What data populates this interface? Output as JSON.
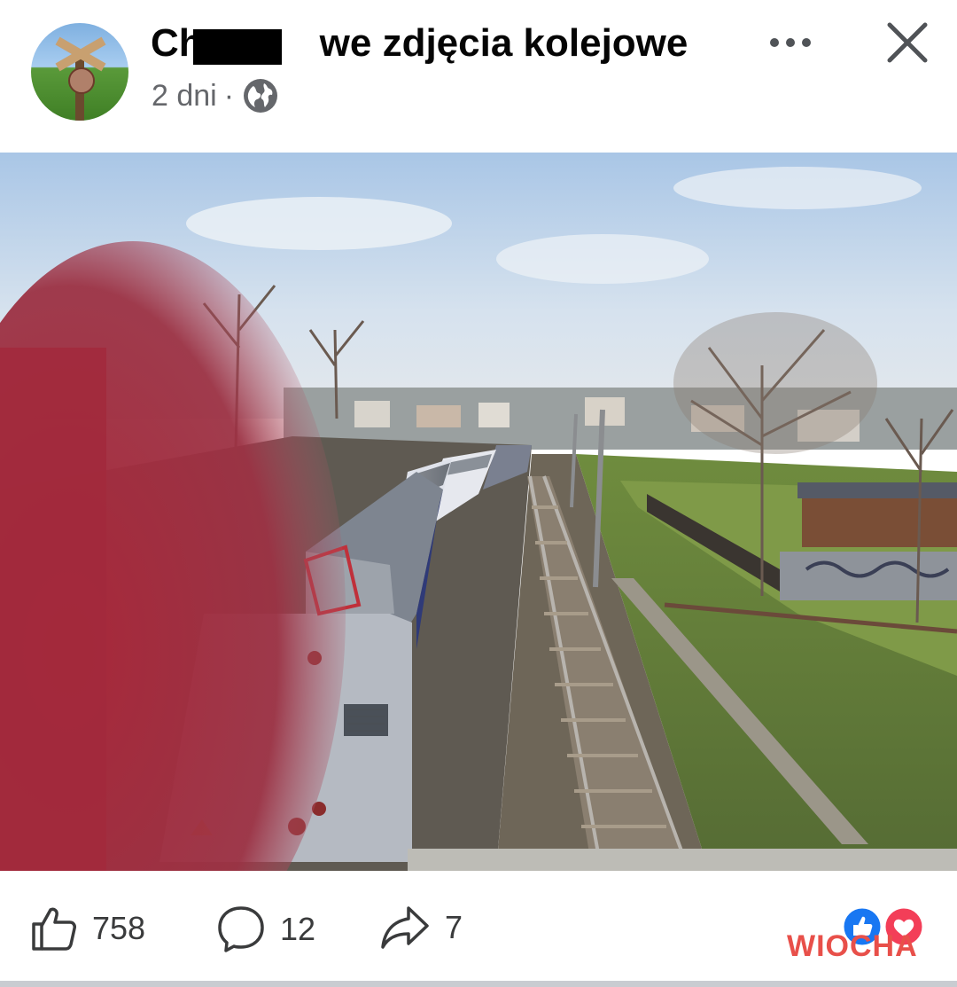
{
  "header": {
    "title_visible": "Ch   we zdjęcia kolejowe",
    "time": "2 dni",
    "separator": "·",
    "privacy_icon": "globe-icon",
    "more_icon": "more-dots-icon",
    "close_icon": "close-icon"
  },
  "photo": {
    "subject": "train"
  },
  "footer": {
    "likes": "758",
    "comments": "12",
    "shares": "7",
    "reactions": [
      "like-reaction-icon",
      "love-reaction-icon"
    ],
    "watermark": "WIOCHA"
  },
  "colors": {
    "text": "#050505",
    "meta": "#65676b",
    "like_blue": "#1877f2",
    "love_red": "#f33e58"
  }
}
